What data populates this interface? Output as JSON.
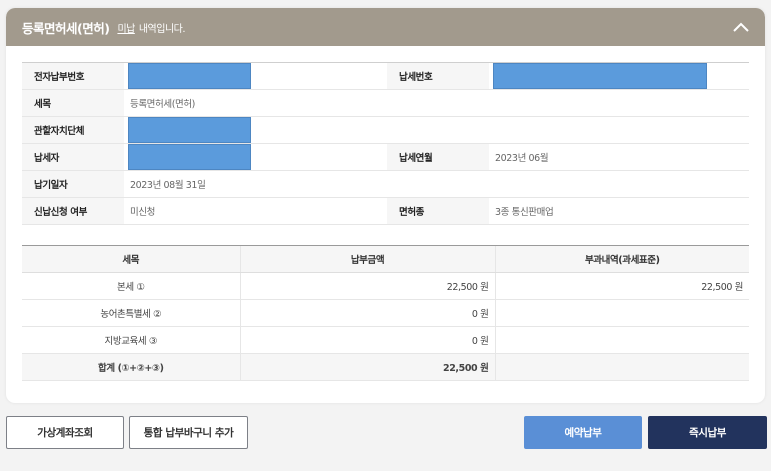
{
  "header": {
    "title": "등록면허세(면허)",
    "unpaid_link": "미납",
    "title_suffix": "내역입니다."
  },
  "info": {
    "electronic_payment_no_label": "전자납부번호",
    "payment_no_label": "납세번호",
    "tax_item_label": "세목",
    "tax_item_value": "등록면허세(면허)",
    "local_government_label": "관할자치단체",
    "taxpayer_label": "납세자",
    "tax_year_month_label": "납세연월",
    "tax_year_month_value": "2023년 06월",
    "due_date_label": "납기일자",
    "due_date_value": "2023년 08월 31일",
    "installment_label": "신납신청 여부",
    "installment_value": "미신청",
    "license_type_label": "면허종",
    "license_type_value": "3종 통신판매업",
    "mask_color": "#5b9bdc"
  },
  "amount_table": {
    "headers": [
      "세목",
      "납부금액",
      "부과내역(과세표준)"
    ],
    "rows": [
      {
        "item": "본세 ①",
        "amount": "22,500 원",
        "basis": "22,500 원"
      },
      {
        "item": "농어촌특별세 ②",
        "amount": "0 원",
        "basis": ""
      },
      {
        "item": "지방교육세 ③",
        "amount": "0 원",
        "basis": ""
      },
      {
        "item": "합계 (①+②+③)",
        "amount": "22,500 원",
        "basis": ""
      }
    ]
  },
  "buttons": {
    "virtual_account": "가상계좌조회",
    "add_to_cart": "통합 납부바구니 추가",
    "reserve_pay": "예약납부",
    "pay_now": "즉시납부"
  },
  "colors": {
    "header_bg": "#a29a8d",
    "reserve_btn": "#5a8fd6",
    "pay_btn": "#22335d"
  }
}
